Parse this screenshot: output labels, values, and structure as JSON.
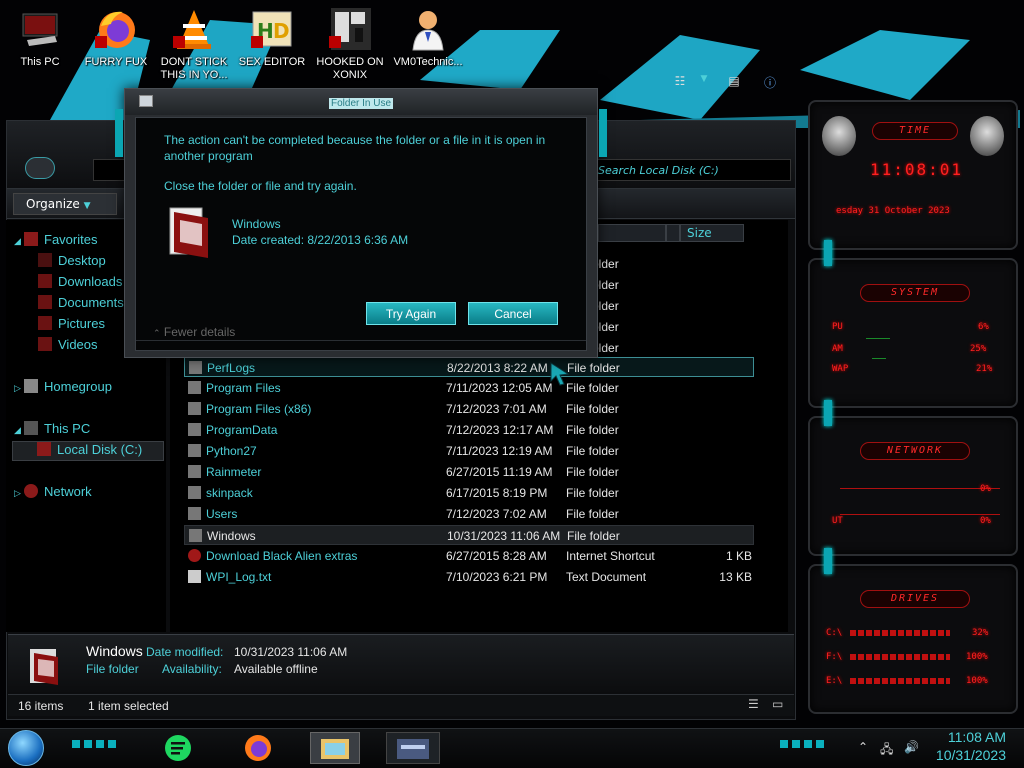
{
  "desktop": {
    "icons": [
      {
        "label": "This PC",
        "icon": "computer-icon"
      },
      {
        "label": "FURRY FUX",
        "icon": "firefox-icon"
      },
      {
        "label": "DONT STICK THIS IN YO...",
        "icon": "vlc-icon"
      },
      {
        "label": "SEX EDITOR",
        "icon": "hxd-icon"
      },
      {
        "label": "HOOKED ON XONIX",
        "icon": "xonix-icon"
      },
      {
        "label": "VM0Technic...",
        "icon": "doctor-icon"
      }
    ]
  },
  "explorer": {
    "search_placeholder": "Search Local Disk (C:)",
    "organize_label": "Organize",
    "columns": {
      "size": "Size"
    },
    "nav": {
      "favorites": "Favorites",
      "favorites_items": [
        "Desktop",
        "Downloads",
        "Documents",
        "Pictures",
        "Videos"
      ],
      "homegroup": "Homegroup",
      "this_pc": "This PC",
      "local_disk": "Local Disk (C:)",
      "network": "Network"
    },
    "hidden_rows_types": [
      "File folder",
      "File folder",
      "File folder",
      "File folder",
      "File folder"
    ],
    "rows": [
      {
        "name": "PerfLogs",
        "date": "8/22/2013 8:22 AM",
        "type": "File folder",
        "size": ""
      },
      {
        "name": "Program Files",
        "date": "7/11/2023 12:05 AM",
        "type": "File folder",
        "size": ""
      },
      {
        "name": "Program Files (x86)",
        "date": "7/12/2023 7:01 AM",
        "type": "File folder",
        "size": ""
      },
      {
        "name": "ProgramData",
        "date": "7/12/2023 12:17 AM",
        "type": "File folder",
        "size": ""
      },
      {
        "name": "Python27",
        "date": "7/11/2023 12:19 AM",
        "type": "File folder",
        "size": ""
      },
      {
        "name": "Rainmeter",
        "date": "6/27/2015 11:19 AM",
        "type": "File folder",
        "size": ""
      },
      {
        "name": "skinpack",
        "date": "6/17/2015 8:19 PM",
        "type": "File folder",
        "size": ""
      },
      {
        "name": "Users",
        "date": "7/12/2023 7:02 AM",
        "type": "File folder",
        "size": ""
      },
      {
        "name": "Windows",
        "date": "10/31/2023 11:06 AM",
        "type": "File folder",
        "size": ""
      },
      {
        "name": "Download Black Alien extras",
        "date": "6/27/2015 8:28 AM",
        "type": "Internet Shortcut",
        "size": "1 KB"
      },
      {
        "name": "WPI_Log.txt",
        "date": "7/10/2023 6:21 PM",
        "type": "Text Document",
        "size": "13 KB"
      }
    ],
    "details": {
      "name": "Windows",
      "type": "File folder",
      "date_modified_label": "Date modified:",
      "date_modified": "10/31/2023 11:06 AM",
      "availability_label": "Availability:",
      "availability": "Available offline"
    },
    "status": {
      "items": "16 items",
      "selected": "1 item selected"
    }
  },
  "dialog": {
    "title": "Folder In Use",
    "message": "The action can't be completed because the folder or a file in it is open in another program",
    "instruction": "Close the folder or file and try again.",
    "item_name": "Windows",
    "item_date": "Date created: 8/22/2013 6:36 AM",
    "try_again": "Try Again",
    "cancel": "Cancel",
    "fewer_details": "Fewer details"
  },
  "widgets": {
    "time_header": "TIME",
    "time_value": "11:08:01",
    "date_value": "esday 31 October 2023",
    "system_header": "SYSTEM",
    "system_rows": [
      {
        "label": "PU",
        "value": "6%"
      },
      {
        "label": "AM",
        "value": "25%"
      },
      {
        "label": "WAP",
        "value": "21%"
      }
    ],
    "network_header": "NETWORK",
    "network_rows": [
      {
        "label": "",
        "value": "0%"
      },
      {
        "label": "UT",
        "value": "0%"
      }
    ],
    "drives_header": "DRIVES",
    "drive_rows": [
      {
        "label": "C:\\",
        "value": "32%"
      },
      {
        "label": "F:\\",
        "value": "100%"
      },
      {
        "label": "E:\\",
        "value": "100%"
      }
    ]
  },
  "taskbar": {
    "time": "11:08 AM",
    "date": "10/31/2023",
    "apps": [
      "spotify-icon",
      "firefox-icon",
      "explorer-icon",
      "control-panel-icon"
    ]
  },
  "colors": {
    "accent": "#4dd0d8",
    "widget_red": "#ff2020",
    "dialog_button": "#1a9aa5"
  }
}
